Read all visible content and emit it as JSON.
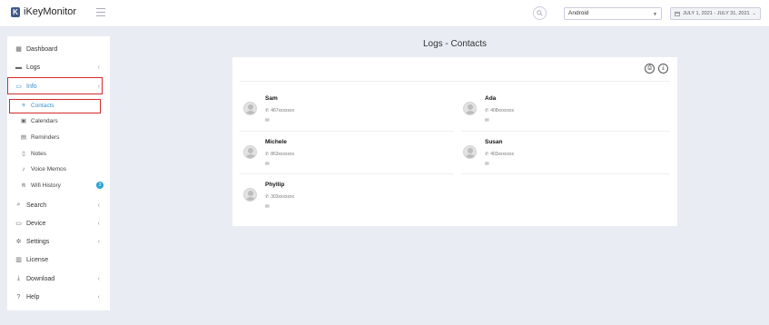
{
  "app": {
    "title": "iKeyMonitor",
    "logo_letter": "K"
  },
  "topbar": {
    "device": "Android",
    "date_range": "JULY 1, 2021 - JULY 31, 2021"
  },
  "sidebar": {
    "items": [
      {
        "label": "Dashboard",
        "icon": "dashboard-icon"
      },
      {
        "label": "Logs",
        "icon": "folder-icon"
      },
      {
        "label": "Info",
        "icon": "folder-open-icon"
      },
      {
        "label": "Search",
        "icon": "search-icon"
      },
      {
        "label": "Device",
        "icon": "monitor-icon"
      },
      {
        "label": "Settings",
        "icon": "gear-icon"
      },
      {
        "label": "License",
        "icon": "barcode-icon"
      },
      {
        "label": "Download",
        "icon": "download-icon"
      },
      {
        "label": "Help",
        "icon": "help-icon"
      }
    ],
    "sub_items": [
      {
        "label": "Contacts",
        "icon": "list-icon"
      },
      {
        "label": "Calendars",
        "icon": "calendar-icon"
      },
      {
        "label": "Reminders",
        "icon": "reminder-icon"
      },
      {
        "label": "Notes",
        "icon": "note-icon"
      },
      {
        "label": "Voice Memos",
        "icon": "microphone-icon"
      },
      {
        "label": "Wifi History",
        "icon": "wifi-icon",
        "badge": "3"
      }
    ]
  },
  "main": {
    "title": "Logs - Contacts",
    "contacts": [
      {
        "name": "Sam",
        "phone": "467xxxxxxx"
      },
      {
        "name": "Ada",
        "phone": "408xxxxxxx"
      },
      {
        "name": "Michele",
        "phone": "863xxxxxxx"
      },
      {
        "name": "Susan",
        "phone": "403xxxxxxx"
      },
      {
        "name": "Phyllip",
        "phone": "303xxxxxxx"
      }
    ]
  },
  "colors": {
    "accent": "#29a3d7",
    "highlight": "#d42a2a",
    "active_text": "#3a8fc9"
  }
}
